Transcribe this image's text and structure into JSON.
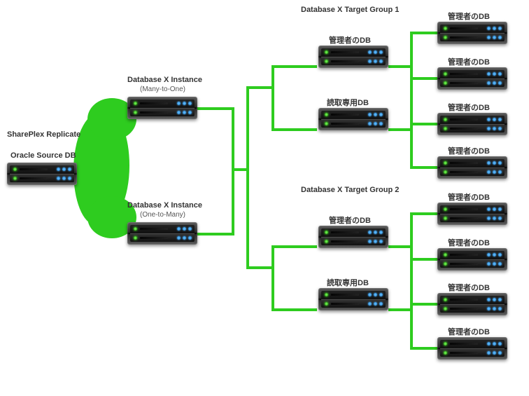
{
  "left": {
    "heading": "SharePlex Replicate",
    "server_label": "Oracle Source DB"
  },
  "dbx": [
    {
      "title": "Database X Instance",
      "sub": "(Many-to-One)"
    },
    {
      "title": "Database X Instance",
      "sub": "(One-to-Many)"
    }
  ],
  "targets": [
    {
      "group": "Database X Target Group 1",
      "members": [
        "管理者のDB",
        "読取専用DB"
      ]
    },
    {
      "group": "Database X Target Group 2",
      "members": [
        "管理者のDB",
        "読取専用DB"
      ]
    }
  ],
  "replicas": [
    "管理者のDB",
    "管理者のDB",
    "管理者のDB",
    "管理者のDB",
    "管理者のDB",
    "管理者のDB",
    "管理者のDB",
    "管理者のDB"
  ]
}
